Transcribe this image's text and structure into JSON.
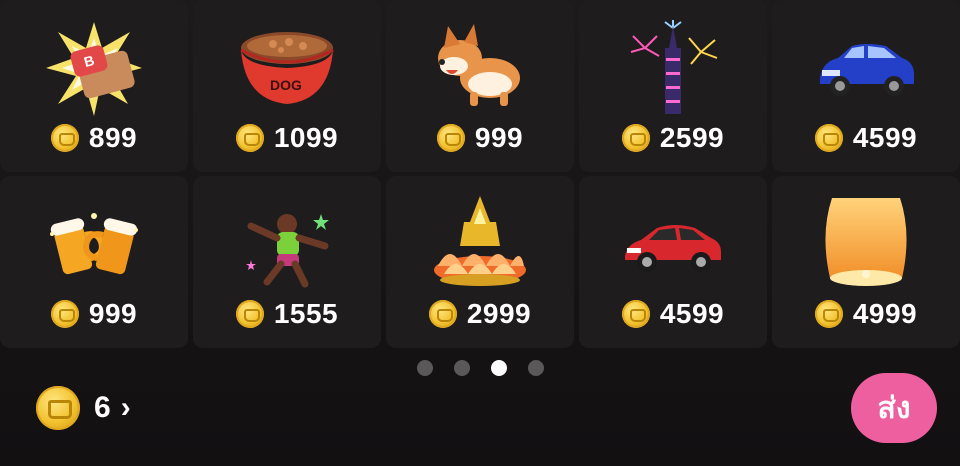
{
  "gifts": [
    {
      "name": "punch-gift-icon",
      "price": "899"
    },
    {
      "name": "dog-food-bowl-icon",
      "price": "1099",
      "label": "DOG"
    },
    {
      "name": "corgi-dog-icon",
      "price": "999"
    },
    {
      "name": "tower-fireworks-icon",
      "price": "2599"
    },
    {
      "name": "blue-sports-car-icon",
      "price": "4599"
    },
    {
      "name": "beer-mugs-icon",
      "price": "999"
    },
    {
      "name": "dancing-man-icon",
      "price": "1555"
    },
    {
      "name": "golden-lotus-krathong-icon",
      "price": "2999"
    },
    {
      "name": "red-sports-car-icon",
      "price": "4599"
    },
    {
      "name": "sky-lantern-icon",
      "price": "4999"
    }
  ],
  "pagination": {
    "count": 4,
    "active_index": 2
  },
  "balance": {
    "value": "6",
    "chevron": "›"
  },
  "send_button": {
    "label": "ส่ง"
  },
  "colors": {
    "send": "#ee5fa0",
    "coin": "#f2c12e",
    "cell": "#1e1c1d"
  }
}
